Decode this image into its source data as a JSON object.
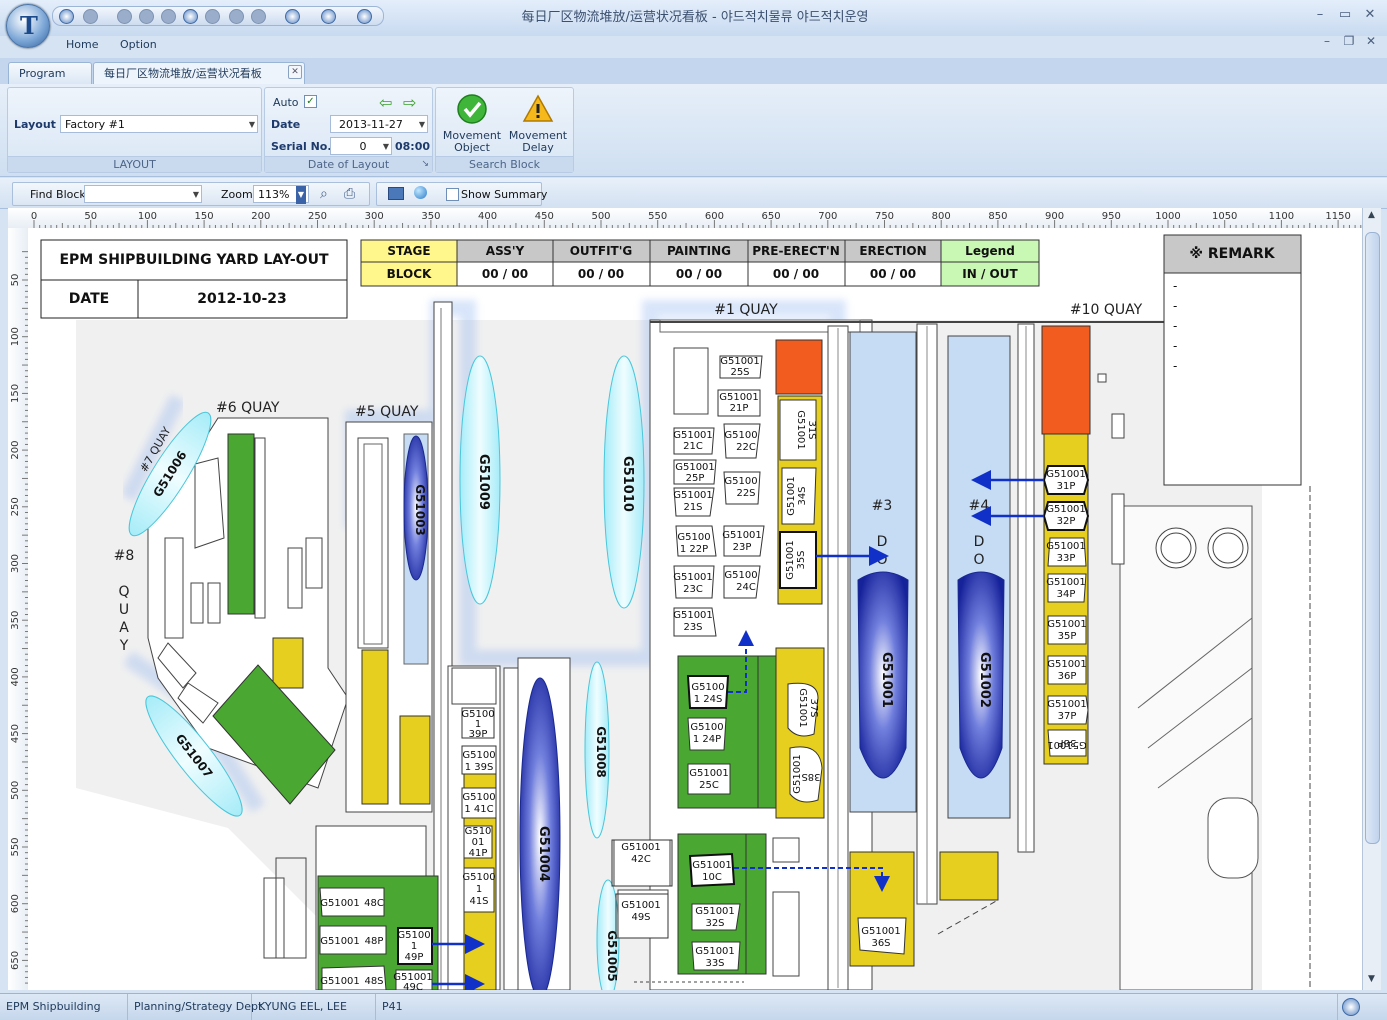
{
  "window": {
    "title": "每日厂区物流堆放/运营状况看板 - 야드적치물류 야드적치운영",
    "orb_letter": "T"
  },
  "menu": [
    "Home",
    "Option"
  ],
  "tabs": [
    {
      "label": "Program"
    },
    {
      "label": "每日厂区物流堆放/运营状况看板"
    }
  ],
  "ribbon": {
    "layout_group": {
      "label": "Layout",
      "value": "Factory #1",
      "caption": "LAYOUT"
    },
    "date_group": {
      "auto_label": "Auto",
      "auto_checked": true,
      "date_label": "Date",
      "date_value": "2013-11-27",
      "serial_label": "Serial No.",
      "serial_value": "0",
      "time_value": "08:00",
      "caption": "Date of Layout"
    },
    "search_group": {
      "movement_object_label": [
        "Movement",
        "Object"
      ],
      "movement_delay_label": [
        "Movement",
        "Delay"
      ],
      "caption": "Search Block"
    }
  },
  "toolbar": {
    "find_block_label": "Find Block",
    "find_block_value": "",
    "zoom_label": "Zoom",
    "zoom_value": "113%",
    "show_summary_label": "Show Summary",
    "show_summary_checked": false
  },
  "ruler": {
    "h": [
      "0",
      "50",
      "100",
      "150",
      "200",
      "250",
      "300",
      "350",
      "400",
      "450",
      "500",
      "550",
      "600",
      "650",
      "700",
      "750",
      "800",
      "850",
      "900",
      "950",
      "1000",
      "1050",
      "1100",
      "1150"
    ],
    "v": [
      "50",
      "100",
      "150",
      "200",
      "250",
      "300",
      "350",
      "400",
      "450",
      "500",
      "550",
      "600",
      "650"
    ]
  },
  "layout": {
    "title": "EPM SHIPBUILDING YARD LAY-OUT",
    "date_label": "DATE",
    "date_value": "2012-10-23",
    "stage_table": {
      "header": [
        "STAGE",
        "ASS'Y",
        "OUTFIT'G",
        "PAINTING",
        "PRE-ERECT'N",
        "ERECTION",
        "Legend"
      ],
      "row": [
        "BLOCK",
        "00 / 00",
        "00 / 00",
        "00 / 00",
        "00 / 00",
        "00 / 00",
        "IN / OUT"
      ]
    },
    "remark": {
      "title": "※ REMARK",
      "items": [
        "-",
        "-",
        "-",
        "-",
        "-"
      ]
    },
    "quays": {
      "q1": "#1 QUAY",
      "q10": "#10 QUAY",
      "q6": "#6 QUAY",
      "q5": "#5 QUAY",
      "q7": "#7 QUAY",
      "q8": [
        "#8",
        "Q",
        "U",
        "A",
        "Y"
      ],
      "d3": [
        "#3",
        "D",
        "O"
      ],
      "d4": [
        "#4",
        "D",
        "O"
      ]
    },
    "ships": [
      "G51006",
      "G51007",
      "G51003",
      "G51009",
      "G51010",
      "G51004",
      "G51008",
      "G51005",
      "G51001",
      "G51002"
    ],
    "blocks": {
      "b25s": [
        "G51001",
        "25S"
      ],
      "b21p": [
        "G51001",
        "21P"
      ],
      "b21c": [
        "G51001",
        "21C"
      ],
      "b22c": [
        "G5100",
        "22C"
      ],
      "b25p": [
        "G51001",
        "25P"
      ],
      "b22s": [
        "G5100",
        "22S"
      ],
      "b21s": [
        "G51001",
        "21S"
      ],
      "b22p": [
        "G5100",
        "1  22P"
      ],
      "b23p": [
        "G51001",
        "23P"
      ],
      "b23c": [
        "G51001",
        "23C"
      ],
      "b24c": [
        "G5100",
        "24C"
      ],
      "b23s": [
        "G51001",
        "23S"
      ],
      "b24s": [
        "G5100",
        "1  24S"
      ],
      "b24p": [
        "G5100",
        "1  24P"
      ],
      "b25c": [
        "G51001",
        "25C"
      ],
      "b31s": [
        "G51001",
        "31S"
      ],
      "b34s": [
        "G51001",
        "34S"
      ],
      "b35s": [
        "G51001",
        "35S"
      ],
      "b37s": [
        "G51001",
        "37S"
      ],
      "b38s": [
        "G51001",
        "38S"
      ],
      "b31p": [
        "G51001",
        "31P"
      ],
      "b32p": [
        "G51001",
        "32P"
      ],
      "b33p": [
        "G51001",
        "33P"
      ],
      "b34p": [
        "G51001",
        "34P"
      ],
      "b35p": [
        "G51001",
        "35P"
      ],
      "b36p": [
        "G51001",
        "36P"
      ],
      "b37p": [
        "G51001",
        "37P"
      ],
      "b38p": [
        "G51001",
        "38P"
      ],
      "b39p": [
        "G5100",
        "1",
        "39P"
      ],
      "b39s": [
        "G5100",
        "1  39S"
      ],
      "b41c": [
        "G5100",
        "1  41C"
      ],
      "b41p": [
        "G510",
        "01",
        "41P"
      ],
      "b41s": [
        "G5100",
        "1",
        "41S"
      ],
      "b42c": [
        "G51001",
        "42C"
      ],
      "b49s": [
        "G51001",
        "49S"
      ],
      "b10c": [
        "G51001",
        "10C"
      ],
      "b32s": [
        "G51001",
        "32S"
      ],
      "b33s": [
        "G51001",
        "33S"
      ],
      "b36s": [
        "G51001",
        "36S"
      ],
      "b48c": [
        "G51001",
        "48C"
      ],
      "b48p": [
        "G51001",
        "48P"
      ],
      "b48s": [
        "G51001",
        "48S"
      ],
      "b49p": [
        "G5100",
        "1",
        "49P"
      ],
      "b49c": [
        "G51001",
        "49C"
      ]
    }
  },
  "colors": {
    "quay_green": "#4aa832",
    "yard_yellow": "#e6cf1e",
    "alert_orange": "#f25c1e",
    "ship_blue": "#2a3fb0",
    "ship_cyan": "#c9f3fb",
    "arrow_blue": "#1030c8",
    "legend_green": "#c9f7b4",
    "header_yellow": "#fff68c"
  },
  "status": [
    "EPM Shipbuilding",
    "Planning/Strategy Dept.",
    "KYUNG EEL, LEE",
    "P41"
  ]
}
